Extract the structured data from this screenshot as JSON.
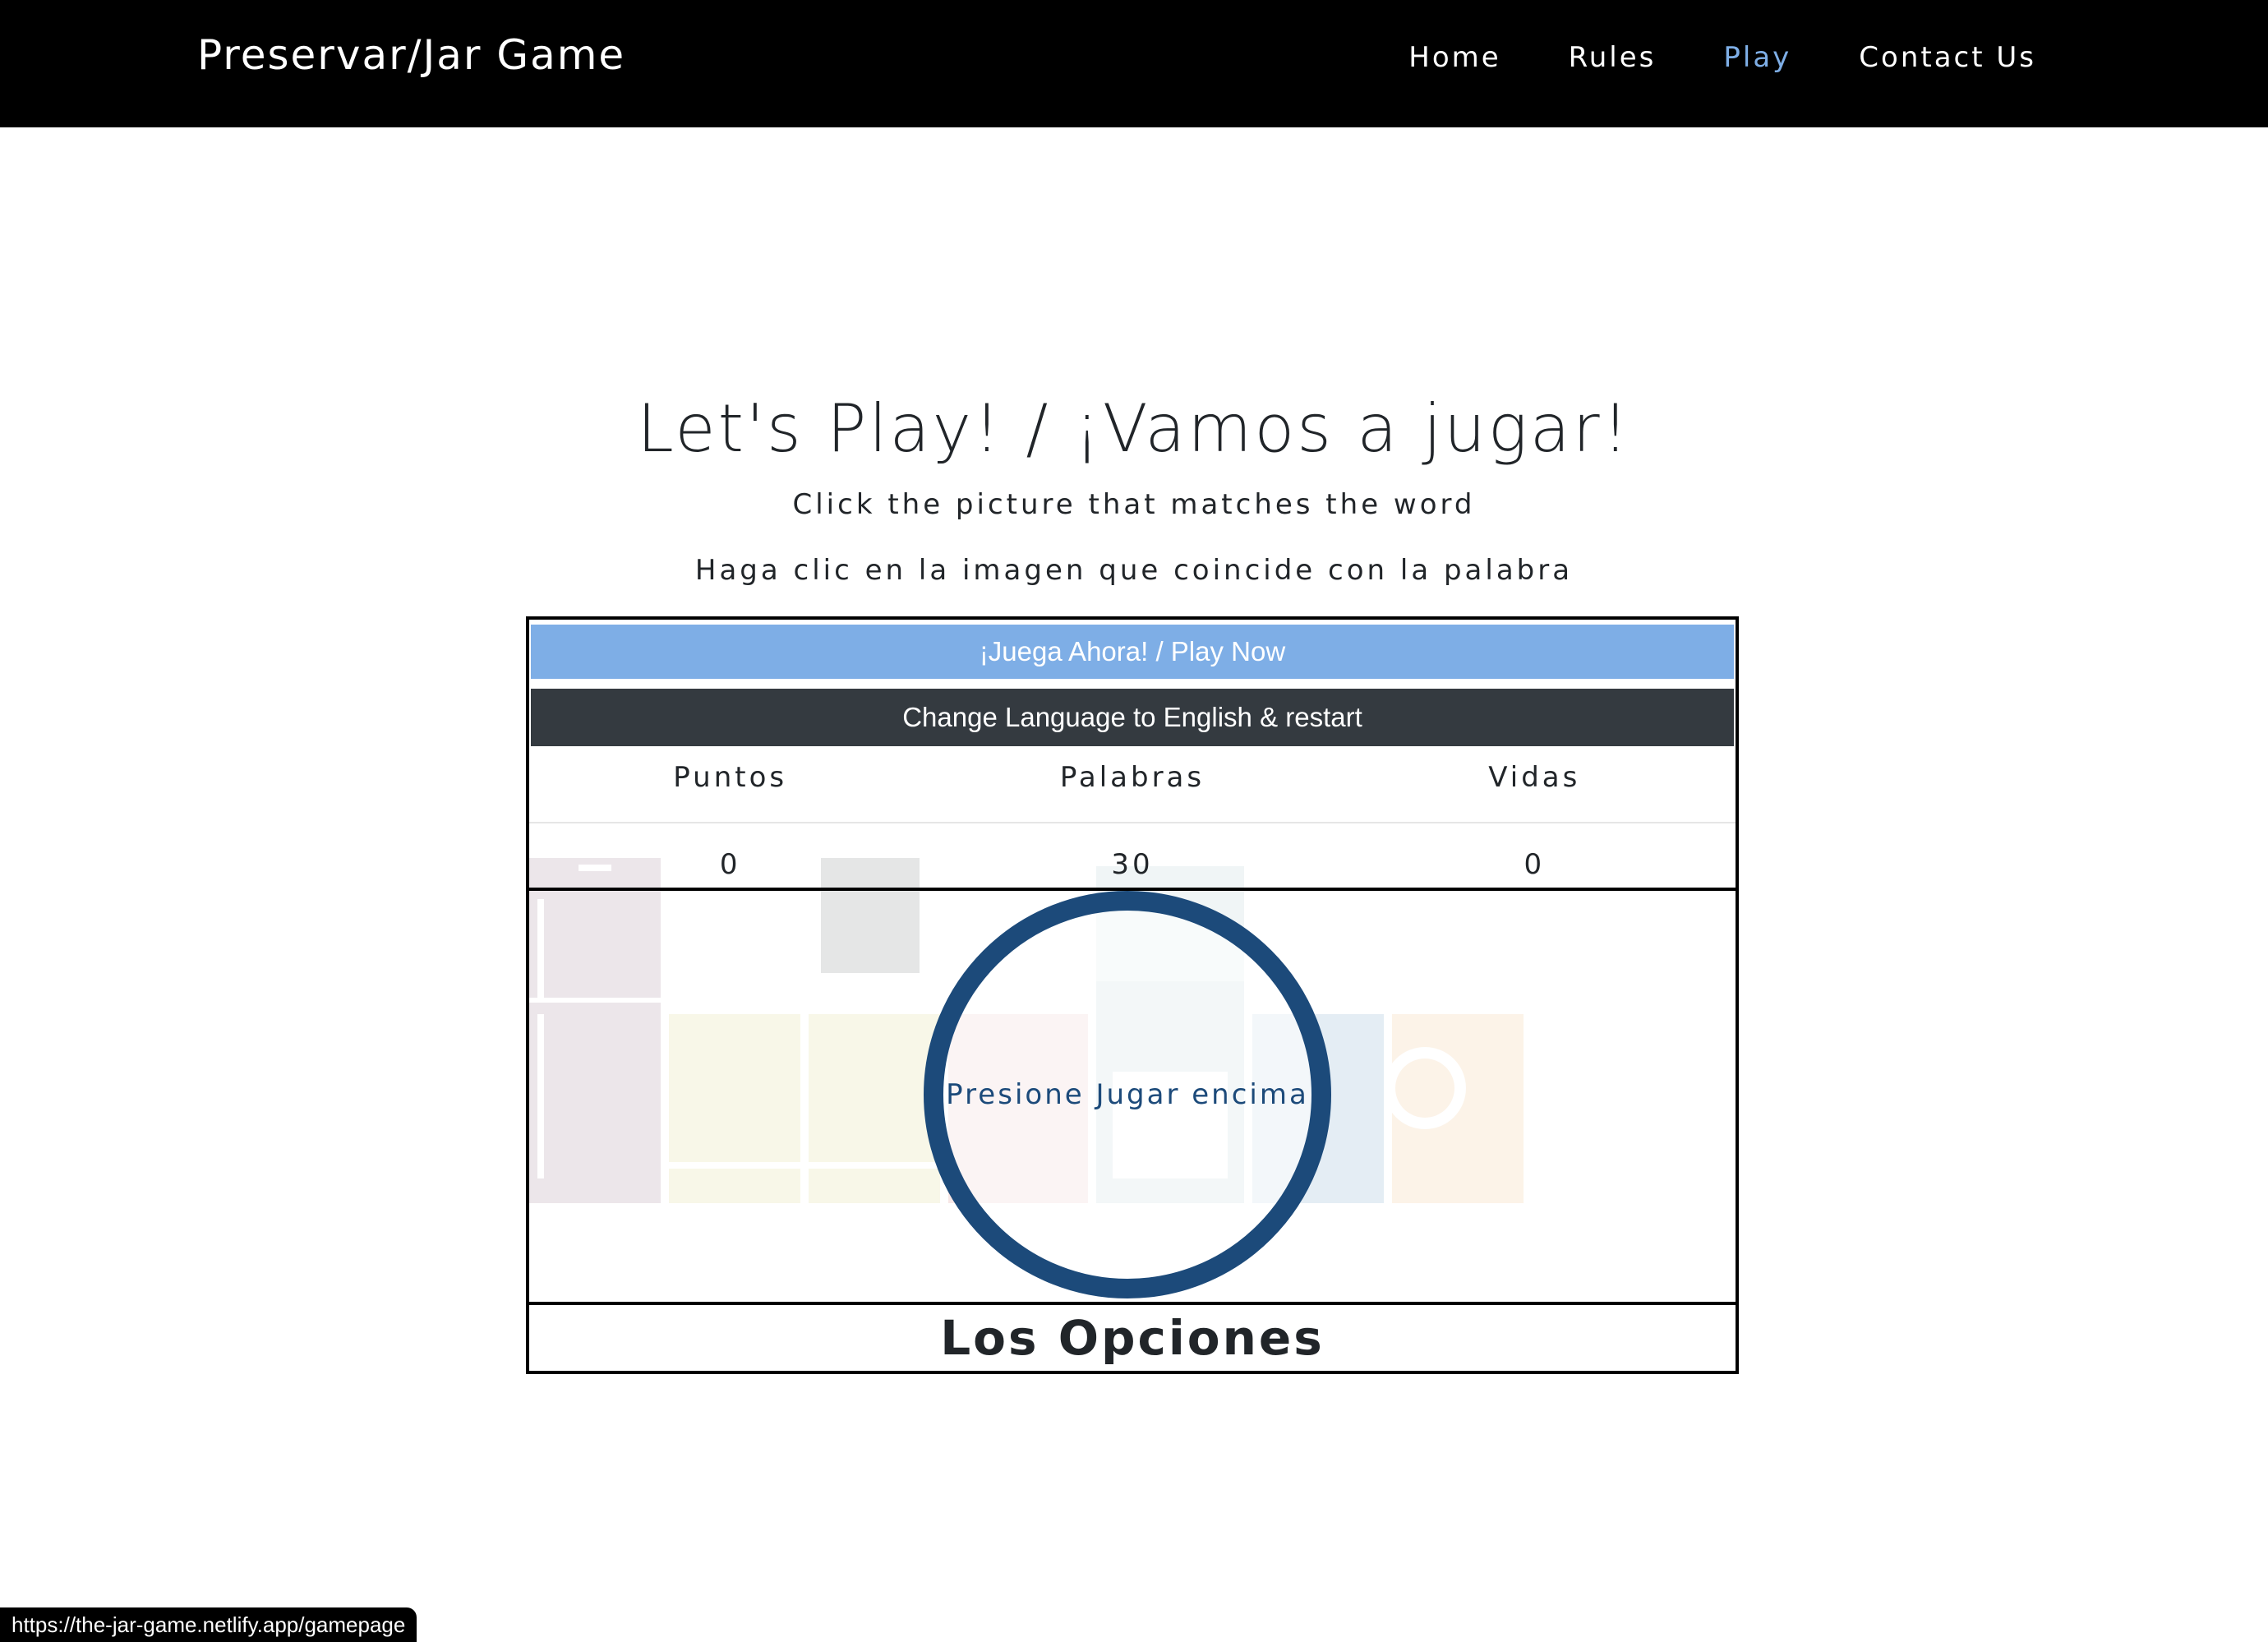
{
  "nav": {
    "brand": "Preservar/Jar Game",
    "links": [
      {
        "label": "Home",
        "active": false
      },
      {
        "label": "Rules",
        "active": false
      },
      {
        "label": "Play",
        "active": true
      },
      {
        "label": "Contact Us",
        "active": false
      }
    ]
  },
  "main": {
    "title": "Let's Play! / ¡Vamos a jugar!",
    "subtitle_en": "Click the picture that matches the word",
    "subtitle_es": "Haga clic en la imagen que coincide con la palabra"
  },
  "game": {
    "play_button": "¡Juega Ahora! / Play Now",
    "language_button": "Change Language to English & restart",
    "stats": {
      "headers": [
        "Puntos",
        "Palabras",
        "Vidas"
      ],
      "values": [
        "0",
        "30",
        "0"
      ]
    },
    "start_prompt": "Presione Jugar encima",
    "options_title": "Los Opciones"
  },
  "status_bar": {
    "url": "https://the-jar-game.netlify.app/gamepage"
  },
  "colors": {
    "accent": "#7eaee6",
    "dark_button": "#343a40",
    "circle": "#1c4a7a",
    "navbar": "#000000"
  }
}
